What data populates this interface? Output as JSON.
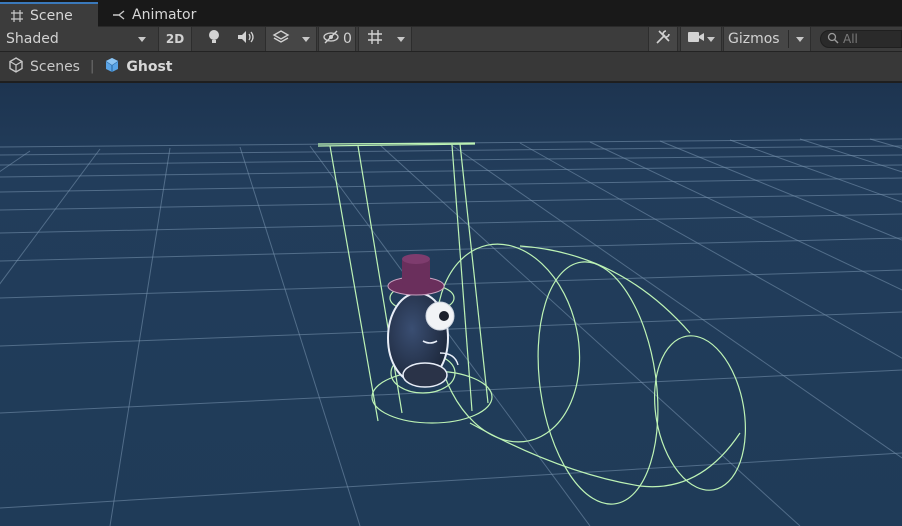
{
  "tabs": [
    {
      "label": "Scene",
      "icon": "grid-icon",
      "active": true
    },
    {
      "label": "Animator",
      "icon": "animator-icon",
      "active": false
    }
  ],
  "toolbar": {
    "draw_mode": "Shaded",
    "toggle_2d": "2D",
    "hidden_count": "0",
    "gizmos_label": "Gizmos",
    "search_placeholder": "All"
  },
  "breadcrumb": {
    "root": "Scenes",
    "current": "Ghost"
  },
  "colors": {
    "sky": "#203a55",
    "grid": "#6d8aa6",
    "gizmo": "#b8f0b0",
    "accent": "#3a79bb",
    "hat": "#6a2f5c"
  }
}
